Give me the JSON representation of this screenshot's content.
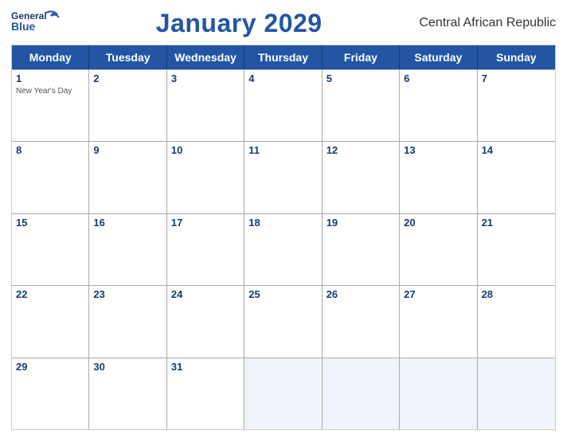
{
  "logo": {
    "line1": "General",
    "line2": "Blue"
  },
  "title": "January 2029",
  "country": "Central African Republic",
  "weekdays": [
    "Monday",
    "Tuesday",
    "Wednesday",
    "Thursday",
    "Friday",
    "Saturday",
    "Sunday"
  ],
  "weeks": [
    [
      {
        "day": "1",
        "event": "New Year's Day",
        "bg": false
      },
      {
        "day": "2",
        "event": "",
        "bg": false
      },
      {
        "day": "3",
        "event": "",
        "bg": false
      },
      {
        "day": "4",
        "event": "",
        "bg": false
      },
      {
        "day": "5",
        "event": "",
        "bg": false
      },
      {
        "day": "6",
        "event": "",
        "bg": false
      },
      {
        "day": "7",
        "event": "",
        "bg": false
      }
    ],
    [
      {
        "day": "8",
        "event": "",
        "bg": false
      },
      {
        "day": "9",
        "event": "",
        "bg": false
      },
      {
        "day": "10",
        "event": "",
        "bg": false
      },
      {
        "day": "11",
        "event": "",
        "bg": false
      },
      {
        "day": "12",
        "event": "",
        "bg": false
      },
      {
        "day": "13",
        "event": "",
        "bg": false
      },
      {
        "day": "14",
        "event": "",
        "bg": false
      }
    ],
    [
      {
        "day": "15",
        "event": "",
        "bg": false
      },
      {
        "day": "16",
        "event": "",
        "bg": false
      },
      {
        "day": "17",
        "event": "",
        "bg": false
      },
      {
        "day": "18",
        "event": "",
        "bg": false
      },
      {
        "day": "19",
        "event": "",
        "bg": false
      },
      {
        "day": "20",
        "event": "",
        "bg": false
      },
      {
        "day": "21",
        "event": "",
        "bg": false
      }
    ],
    [
      {
        "day": "22",
        "event": "",
        "bg": false
      },
      {
        "day": "23",
        "event": "",
        "bg": false
      },
      {
        "day": "24",
        "event": "",
        "bg": false
      },
      {
        "day": "25",
        "event": "",
        "bg": false
      },
      {
        "day": "26",
        "event": "",
        "bg": false
      },
      {
        "day": "27",
        "event": "",
        "bg": false
      },
      {
        "day": "28",
        "event": "",
        "bg": false
      }
    ],
    [
      {
        "day": "29",
        "event": "",
        "bg": false
      },
      {
        "day": "30",
        "event": "",
        "bg": false
      },
      {
        "day": "31",
        "event": "",
        "bg": false
      },
      {
        "day": "",
        "event": "",
        "bg": true
      },
      {
        "day": "",
        "event": "",
        "bg": true
      },
      {
        "day": "",
        "event": "",
        "bg": true
      },
      {
        "day": "",
        "event": "",
        "bg": true
      }
    ]
  ]
}
